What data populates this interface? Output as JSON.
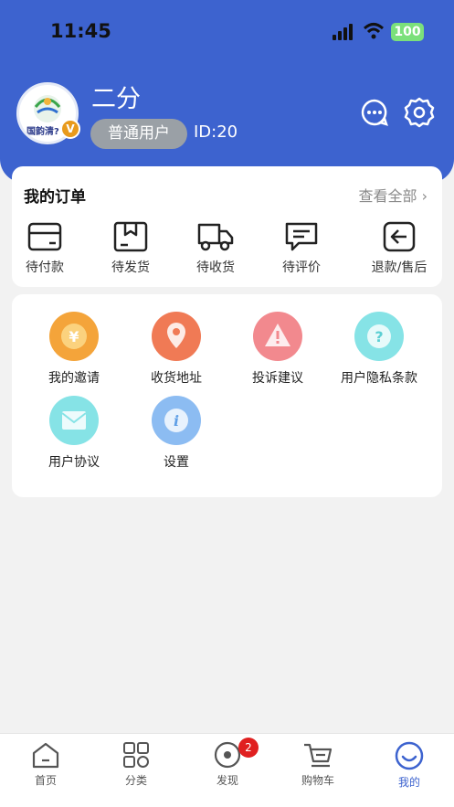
{
  "status_bar": {
    "time": "11:45",
    "battery": "100"
  },
  "profile": {
    "avatar_text": "国韵清?",
    "vip_badge": "V",
    "name": "二分",
    "role": "普通用户",
    "id": "ID:20"
  },
  "orders": {
    "title": "我的订单",
    "view_all": "查看全部",
    "items": [
      {
        "label": "待付款",
        "icon": "wallet-icon"
      },
      {
        "label": "待发货",
        "icon": "package-icon"
      },
      {
        "label": "待收货",
        "icon": "truck-icon"
      },
      {
        "label": "待评价",
        "icon": "comment-icon"
      },
      {
        "label": "退款/售后",
        "icon": "return-icon"
      }
    ]
  },
  "services": {
    "items": [
      {
        "label": "我的邀请",
        "icon": "yen-coin-icon",
        "color": "#f4a43a"
      },
      {
        "label": "收货地址",
        "icon": "location-pin-icon",
        "color": "#f07a55"
      },
      {
        "label": "投诉建议",
        "icon": "warning-icon",
        "color": "#f2898e"
      },
      {
        "label": "用户隐私条款",
        "icon": "question-icon",
        "color": "#86e3e6"
      },
      {
        "label": "用户协议",
        "icon": "envelope-icon",
        "color": "#86e3e6"
      },
      {
        "label": "设置",
        "icon": "info-icon",
        "color": "#8cbcf2"
      }
    ]
  },
  "tabbar": {
    "tabs": [
      {
        "label": "首页",
        "icon": "home-icon"
      },
      {
        "label": "分类",
        "icon": "grid-icon"
      },
      {
        "label": "发现",
        "icon": "discover-icon",
        "badge": "2"
      },
      {
        "label": "购物车",
        "icon": "cart-icon"
      },
      {
        "label": "我的",
        "icon": "smile-icon",
        "active": true
      }
    ]
  },
  "colors": {
    "primary": "#3d63cf",
    "badge_red": "#e02020"
  }
}
